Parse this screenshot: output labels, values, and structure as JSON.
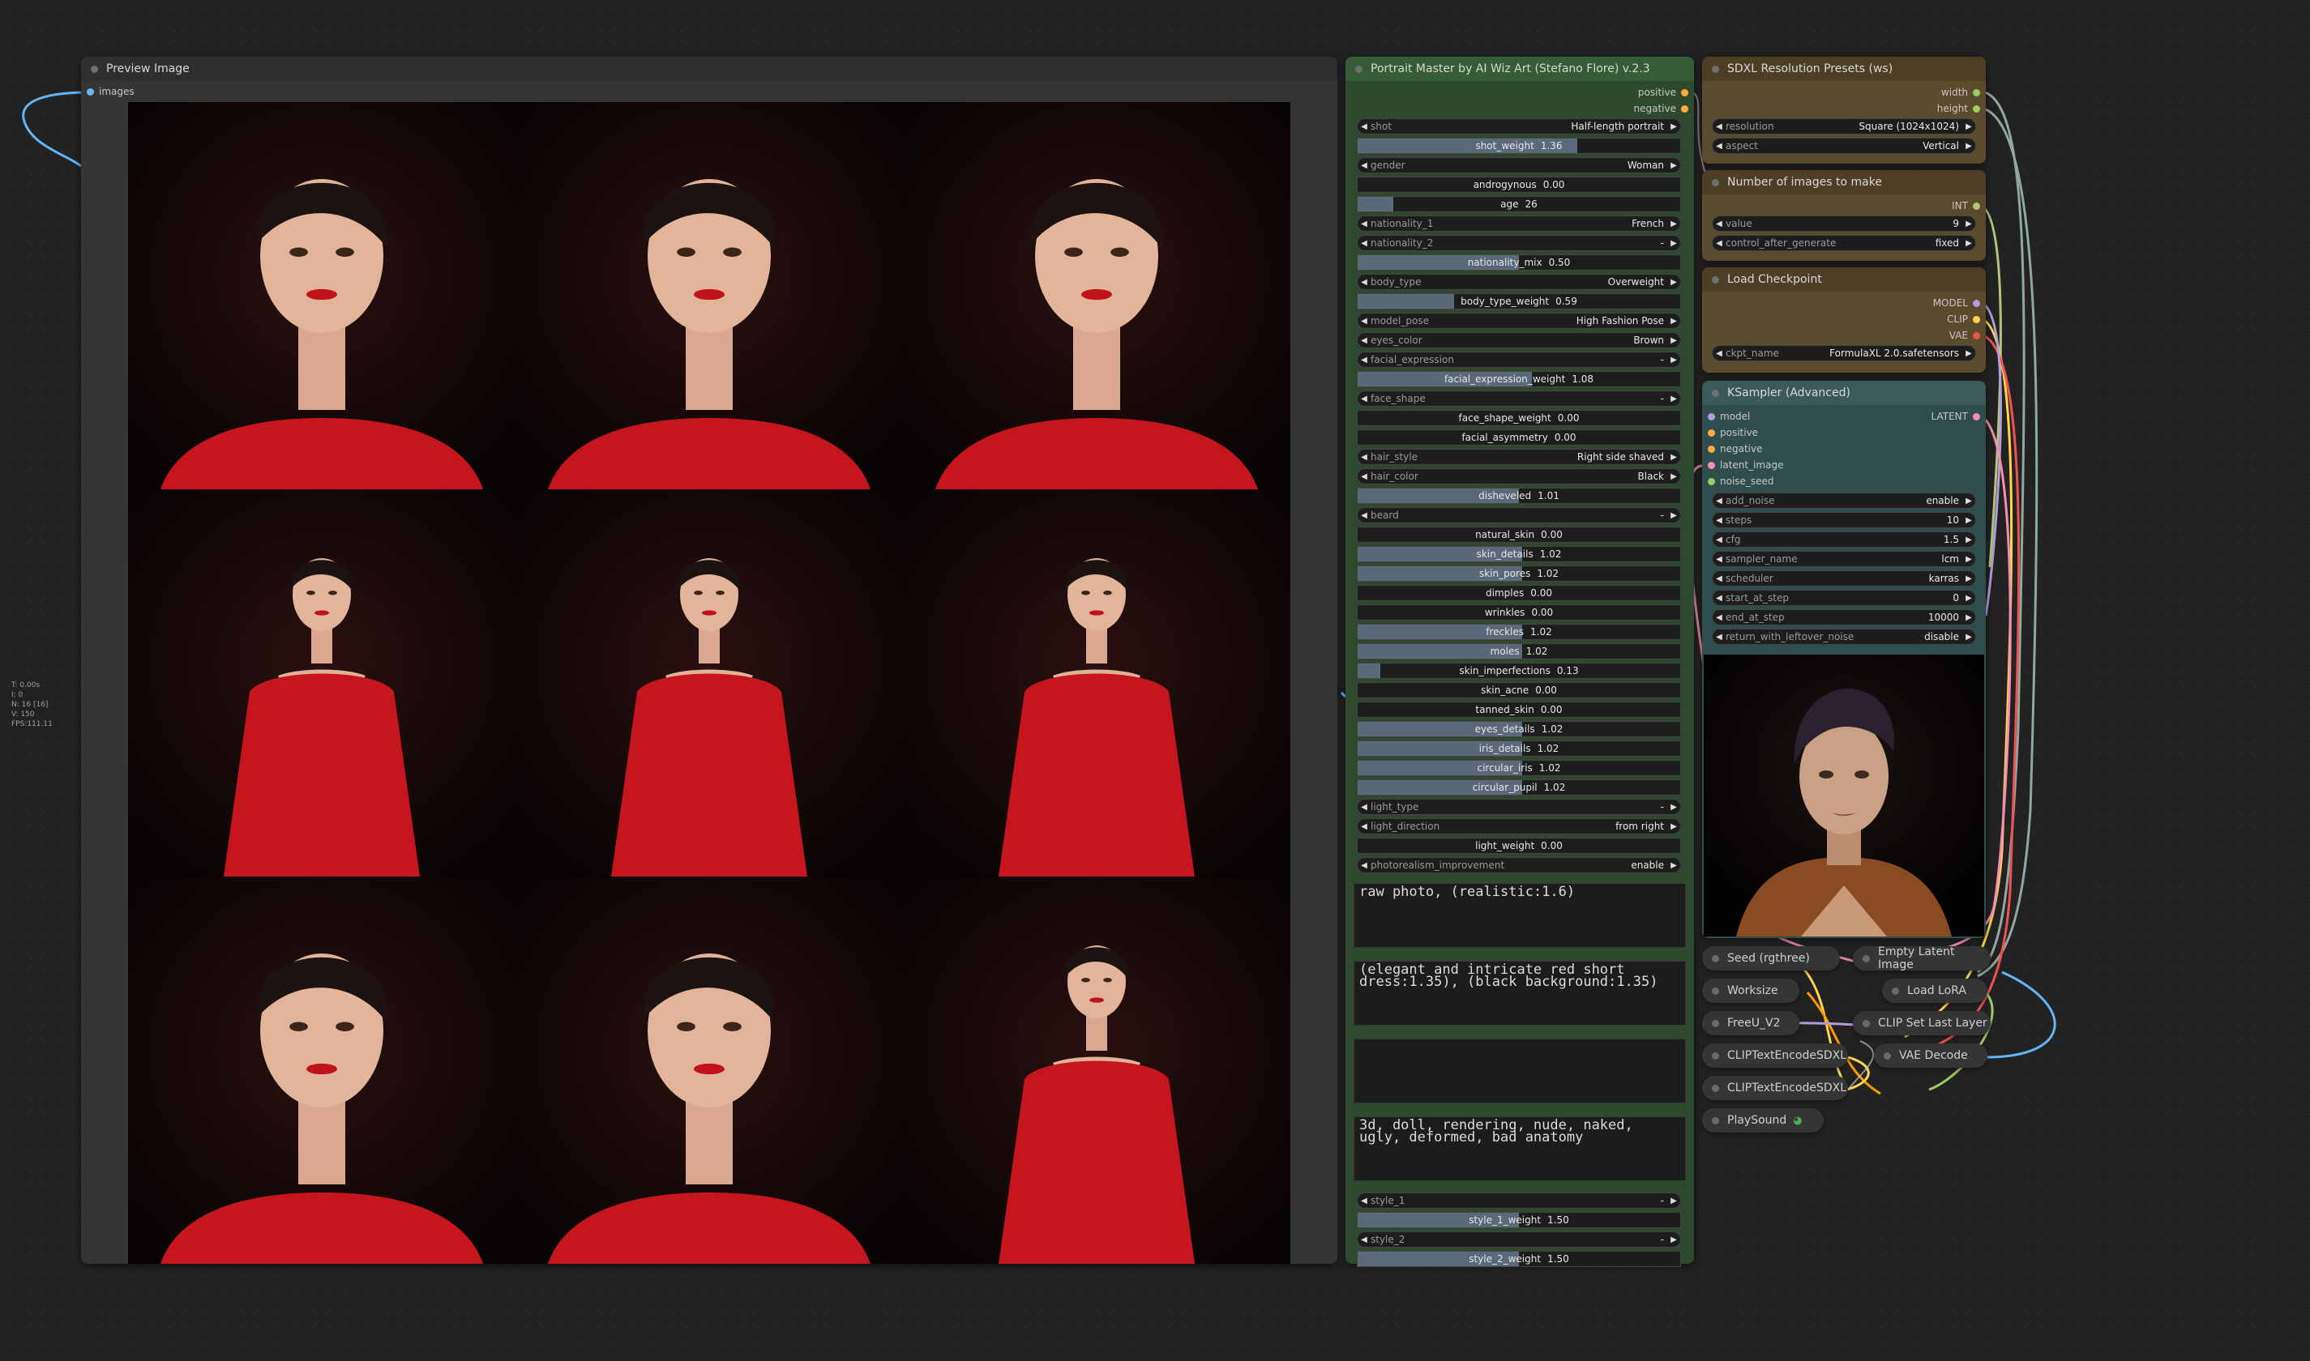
{
  "canvas": {
    "background": "#222222"
  },
  "stats": {
    "t": "T: 0.00s",
    "i": "I: 0",
    "n": "N: 16 [16]",
    "v": "V: 150",
    "fps": "FPS:111.11"
  },
  "preview": {
    "title": "Preview Image",
    "input_label": "images",
    "image_count": 9
  },
  "portrait": {
    "title": "Portrait Master by AI Wiz Art (Stefano Flore) v.2.3",
    "outputs": [
      "positive",
      "negative"
    ],
    "widgets": [
      {
        "type": "combo",
        "label": "shot",
        "value": "Half-length portrait"
      },
      {
        "type": "slider",
        "label": "shot_weight",
        "value": "1.36",
        "fill": 0.68
      },
      {
        "type": "combo",
        "label": "gender",
        "value": "Woman"
      },
      {
        "type": "slider",
        "label": "androgynous",
        "value": "0.00",
        "fill": 0
      },
      {
        "type": "slider",
        "label": "age",
        "value": "26",
        "fill": 0.11
      },
      {
        "type": "combo",
        "label": "nationality_1",
        "value": "French"
      },
      {
        "type": "combo",
        "label": "nationality_2",
        "value": "-"
      },
      {
        "type": "slider",
        "label": "nationality_mix",
        "value": "0.50",
        "fill": 0.5
      },
      {
        "type": "combo",
        "label": "body_type",
        "value": "Overweight"
      },
      {
        "type": "slider",
        "label": "body_type_weight",
        "value": "0.59",
        "fill": 0.3
      },
      {
        "type": "combo",
        "label": "model_pose",
        "value": "High Fashion Pose"
      },
      {
        "type": "combo",
        "label": "eyes_color",
        "value": "Brown"
      },
      {
        "type": "combo",
        "label": "facial_expression",
        "value": "-"
      },
      {
        "type": "slider",
        "label": "facial_expression_weight",
        "value": "1.08",
        "fill": 0.54
      },
      {
        "type": "combo",
        "label": "face_shape",
        "value": "-"
      },
      {
        "type": "slider",
        "label": "face_shape_weight",
        "value": "0.00",
        "fill": 0
      },
      {
        "type": "slider",
        "label": "facial_asymmetry",
        "value": "0.00",
        "fill": 0
      },
      {
        "type": "combo",
        "label": "hair_style",
        "value": "Right side shaved"
      },
      {
        "type": "combo",
        "label": "hair_color",
        "value": "Black"
      },
      {
        "type": "slider",
        "label": "disheveled",
        "value": "1.01",
        "fill": 0.5
      },
      {
        "type": "combo",
        "label": "beard",
        "value": "-"
      },
      {
        "type": "slider",
        "label": "natural_skin",
        "value": "0.00",
        "fill": 0
      },
      {
        "type": "slider",
        "label": "skin_details",
        "value": "1.02",
        "fill": 0.51
      },
      {
        "type": "slider",
        "label": "skin_pores",
        "value": "1.02",
        "fill": 0.51
      },
      {
        "type": "slider",
        "label": "dimples",
        "value": "0.00",
        "fill": 0
      },
      {
        "type": "slider",
        "label": "wrinkles",
        "value": "0.00",
        "fill": 0
      },
      {
        "type": "slider",
        "label": "freckles",
        "value": "1.02",
        "fill": 0.51
      },
      {
        "type": "slider",
        "label": "moles",
        "value": "1.02",
        "fill": 0.51
      },
      {
        "type": "slider",
        "label": "skin_imperfections",
        "value": "0.13",
        "fill": 0.07
      },
      {
        "type": "slider",
        "label": "skin_acne",
        "value": "0.00",
        "fill": 0
      },
      {
        "type": "slider",
        "label": "tanned_skin",
        "value": "0.00",
        "fill": 0
      },
      {
        "type": "slider",
        "label": "eyes_details",
        "value": "1.02",
        "fill": 0.51
      },
      {
        "type": "slider",
        "label": "iris_details",
        "value": "1.02",
        "fill": 0.51
      },
      {
        "type": "slider",
        "label": "circular_iris",
        "value": "1.02",
        "fill": 0.51
      },
      {
        "type": "slider",
        "label": "circular_pupil",
        "value": "1.02",
        "fill": 0.51
      },
      {
        "type": "combo",
        "label": "light_type",
        "value": "-"
      },
      {
        "type": "combo",
        "label": "light_direction",
        "value": "from right"
      },
      {
        "type": "slider",
        "label": "light_weight",
        "value": "0.00",
        "fill": 0
      },
      {
        "type": "combo",
        "label": "photorealism_improvement",
        "value": "enable"
      }
    ],
    "texts": [
      "raw photo, (realistic:1.6)",
      "(elegant and intricate red short dress:1.35), (black background:1.35)",
      "",
      "3d, doll, rendering, nude, naked, ugly, deformed, bad anatomy"
    ],
    "bottom_widgets": [
      {
        "type": "combo",
        "label": "style_1",
        "value": "-"
      },
      {
        "type": "slider",
        "label": "style_1_weight",
        "value": "1.50",
        "fill": 0.5
      },
      {
        "type": "combo",
        "label": "style_2",
        "value": "-"
      },
      {
        "type": "slider",
        "label": "style_2_weight",
        "value": "1.50",
        "fill": 0.5
      }
    ]
  },
  "sdxl": {
    "title": "SDXL Resolution Presets (ws)",
    "outputs": [
      "width",
      "height"
    ],
    "widgets": [
      {
        "label": "resolution",
        "value": "Square (1024x1024)"
      },
      {
        "label": "aspect",
        "value": "Vertical"
      }
    ]
  },
  "numimg": {
    "title": "Number of images to make",
    "output": "INT",
    "widgets": [
      {
        "label": "value",
        "value": "9"
      },
      {
        "label": "control_after_generate",
        "value": "fixed"
      }
    ]
  },
  "ckpt": {
    "title": "Load Checkpoint",
    "outputs": [
      "MODEL",
      "CLIP",
      "VAE"
    ],
    "widgets": [
      {
        "label": "ckpt_name",
        "value": "FormulaXL 2.0.safetensors"
      }
    ]
  },
  "ksampler": {
    "title": "KSampler (Advanced)",
    "inputs": [
      "model",
      "positive",
      "negative",
      "latent_image",
      "noise_seed"
    ],
    "output": "LATENT",
    "widgets": [
      {
        "label": "add_noise",
        "value": "enable"
      },
      {
        "label": "steps",
        "value": "10"
      },
      {
        "label": "cfg",
        "value": "1.5"
      },
      {
        "label": "sampler_name",
        "value": "lcm"
      },
      {
        "label": "scheduler",
        "value": "karras"
      },
      {
        "label": "start_at_step",
        "value": "0"
      },
      {
        "label": "end_at_step",
        "value": "10000"
      },
      {
        "label": "return_with_leftover_noise",
        "value": "disable"
      }
    ]
  },
  "collapsed": {
    "seed": "Seed (rgthree)",
    "empty_latent": "Empty Latent Image",
    "worksize": "Worksize",
    "load_lora": "Load LoRA",
    "freeu": "FreeU_V2",
    "clip_set_last": "CLIP Set Last Layer",
    "clip_text_1": "CLIPTextEncodeSDXL",
    "vae_decode": "VAE Decode",
    "clip_text_2": "CLIPTextEncodeSDXL",
    "playsound": "PlaySound"
  },
  "colors": {
    "green_node": "#2e4a2e",
    "green_title": "#355c35",
    "brown_node": "#5b4a2c",
    "teal_node": "#2f4d4d",
    "teal_title": "#3a5a5a",
    "node_bg": "#353535"
  }
}
